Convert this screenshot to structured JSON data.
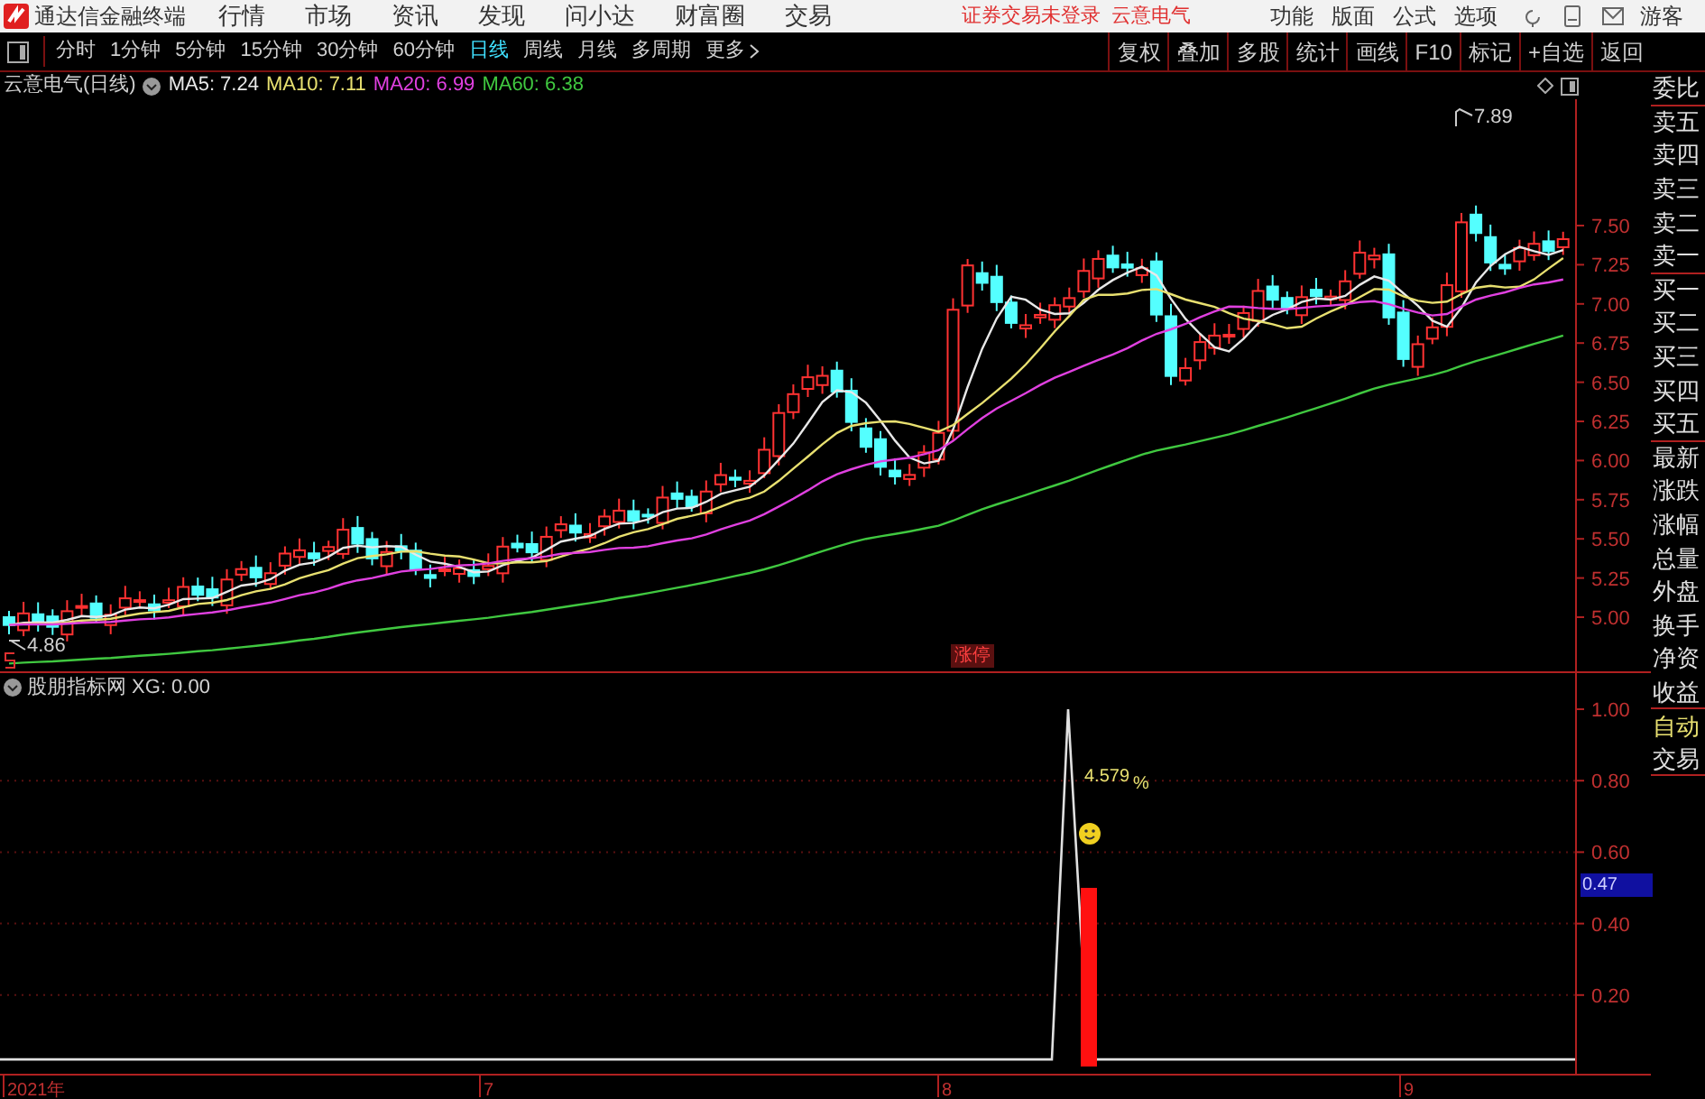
{
  "menu_bar": {
    "app_title": "通达信金融终端",
    "menus": [
      "行情",
      "市场",
      "资讯",
      "发现",
      "问小达",
      "财富圈",
      "交易"
    ],
    "login_status": "证券交易未登录",
    "stock_name": "云意电气",
    "tools": [
      "功能",
      "版面",
      "公式",
      "选项"
    ],
    "user": "游客"
  },
  "toolbar": {
    "periods": [
      {
        "label": "分时",
        "selected": false
      },
      {
        "label": "1分钟",
        "selected": false
      },
      {
        "label": "5分钟",
        "selected": false
      },
      {
        "label": "15分钟",
        "selected": false
      },
      {
        "label": "30分钟",
        "selected": false
      },
      {
        "label": "60分钟",
        "selected": false
      },
      {
        "label": "日线",
        "selected": true
      },
      {
        "label": "周线",
        "selected": false
      },
      {
        "label": "月线",
        "selected": false
      },
      {
        "label": "多周期",
        "selected": false
      }
    ],
    "more": "更多",
    "actions": [
      "复权",
      "叠加",
      "多股",
      "统计",
      "画线",
      "F10",
      "标记",
      "+自选",
      "返回"
    ]
  },
  "main_chart": {
    "title": "云意电气(日线)",
    "ma": [
      {
        "label": "MA5: 7.24",
        "color": "#e8e8e8"
      },
      {
        "label": "MA10: 7.11",
        "color": "#e8e070"
      },
      {
        "label": "MA20: 6.99",
        "color": "#e040e0"
      },
      {
        "label": "MA60: 6.38",
        "color": "#40c840"
      }
    ],
    "price_axis": [
      "7.50",
      "7.25",
      "7.00",
      "6.75",
      "6.50",
      "6.25",
      "6.00",
      "5.75",
      "5.50",
      "5.25",
      "5.00"
    ],
    "high_label": "7.89",
    "low_label": "4.86",
    "limit_up_tag": "涨停"
  },
  "indicator": {
    "title": "股朋指标网 XG: 0.00",
    "axis": [
      "1.00",
      "0.80",
      "0.60",
      "0.40",
      "0.20"
    ],
    "value_tag": "0.47",
    "signal_label": "4.579",
    "signal_unit": "%"
  },
  "date_axis": [
    "2021年",
    "7",
    "8",
    "9"
  ],
  "side_panel": [
    {
      "label": "委比",
      "kind": "quote",
      "divider_after": true
    },
    {
      "label": "卖五",
      "kind": "quote",
      "divider_after": false
    },
    {
      "label": "卖四",
      "kind": "quote",
      "divider_after": false
    },
    {
      "label": "卖三",
      "kind": "quote",
      "divider_after": false
    },
    {
      "label": "卖二",
      "kind": "quote",
      "divider_after": false
    },
    {
      "label": "卖一",
      "kind": "quote",
      "divider_after": true
    },
    {
      "label": "买一",
      "kind": "quote",
      "divider_after": false
    },
    {
      "label": "买二",
      "kind": "quote",
      "divider_after": false
    },
    {
      "label": "买三",
      "kind": "quote",
      "divider_after": false
    },
    {
      "label": "买四",
      "kind": "quote",
      "divider_after": false
    },
    {
      "label": "买五",
      "kind": "quote",
      "divider_after": true
    },
    {
      "label": "最新",
      "kind": "quote",
      "divider_after": false
    },
    {
      "label": "涨跌",
      "kind": "quote",
      "divider_after": false
    },
    {
      "label": "涨幅",
      "kind": "quote",
      "divider_after": false
    },
    {
      "label": "总量",
      "kind": "quote",
      "divider_after": false
    },
    {
      "label": "外盘",
      "kind": "quote",
      "divider_after": false
    },
    {
      "label": "换手",
      "kind": "quote",
      "divider_after": false
    },
    {
      "label": "净资",
      "kind": "quote",
      "divider_after": false
    },
    {
      "label": "收益",
      "kind": "quote",
      "divider_after": true
    },
    {
      "label": "自动",
      "kind": "mode",
      "divider_after": false
    },
    {
      "label": "交易",
      "kind": "quote",
      "divider_after": true
    }
  ]
}
